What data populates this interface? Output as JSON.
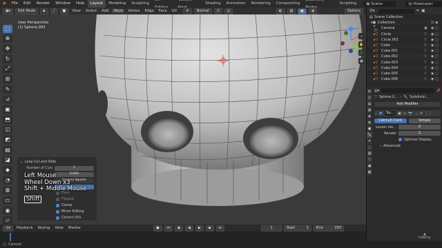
{
  "menus": [
    "File",
    "Edit",
    "Render",
    "Window",
    "Help"
  ],
  "workspaces": [
    "Layout",
    "Modeling",
    "Sculpting",
    "UV Editing",
    "Texture Paint",
    "Shading",
    "Animation",
    "Rendering",
    "Compositing",
    "Geometry Nodes",
    "Scripting"
  ],
  "active_workspace": "Layout",
  "scene": "Scene",
  "view_layer": "ViewLayer",
  "header": {
    "mode": "Edit Mode",
    "menus": [
      "View",
      "Select",
      "Add",
      "Mesh",
      "Vertex",
      "Edge",
      "Face",
      "UV"
    ],
    "orientation": "Normal",
    "options": "Options"
  },
  "viewport": {
    "view_name": "User Perspective",
    "object_name": "(1) Sphere.002"
  },
  "operator_panel": {
    "title": "Loop Cut and Slide",
    "cuts_label": "Number of Cuts",
    "cuts_value": "1",
    "smoothness_value": "0.000",
    "falloff_value": "Inverse Square",
    "even_label": "Even",
    "flipped_label": "Flipped",
    "clamp_label": "Clamp",
    "mirror_label": "Mirror Editing",
    "uvs_label": "Correct UVs"
  },
  "key_overlay": {
    "line1": "Left Mouse",
    "line2": "Wheel Down x3",
    "line3": "Shift + Middle Mouse",
    "button": "Shift"
  },
  "timeline": {
    "menus": [
      "Playback",
      "Keying",
      "View",
      "Marker"
    ],
    "current_frame": "1",
    "start_label": "Start",
    "start": "1",
    "end_label": "End",
    "end": "250"
  },
  "status": "Cancel",
  "outliner": {
    "title": "Scene Collection",
    "collection": "Collection",
    "items": [
      "Camera",
      "Circle",
      "Circle.001",
      "Cube",
      "Cube.001",
      "Cube.002",
      "Cube.003",
      "Cube.004",
      "Cube.005",
      "Cube.006"
    ]
  },
  "properties": {
    "object": "Sphere.0...",
    "modifier_tab": "Subdivisi...",
    "add_modifier": "Add Modifier",
    "modifier_name": "Su...",
    "catmull": "Catmull-Clark",
    "simple": "Simple",
    "levels_label": "Levels Vie...",
    "levels": "2",
    "render_label": "Render",
    "render": "2",
    "optimal": "Optimal Display",
    "advanced": "Advanced"
  },
  "watermark": "Udemy",
  "colors": {
    "accent": "#4772b3",
    "object_orange": "#e8a34f",
    "mesh_green": "#7fd17f"
  }
}
